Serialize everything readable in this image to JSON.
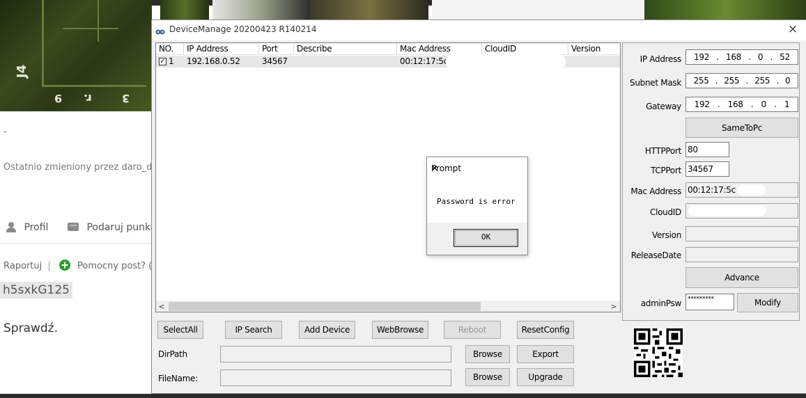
{
  "background_page": {
    "dash": "-",
    "edited_by": "Ostatnio zmieniony przez daro_da",
    "profile_link": "Profil",
    "donate_link": "Podaruj punkt",
    "report_link": "Raportuj",
    "separator": "|",
    "helpful_link": "Pomocny post? (",
    "code_text": "h5sxkG125",
    "reply_text": "Sprawdź.",
    "pcb_labels": [
      "J4",
      "9",
      "r.",
      "3"
    ]
  },
  "window": {
    "title": "DeviceManage 20200423 R140214",
    "close_glyph": "×"
  },
  "table": {
    "columns": [
      "NO.",
      "IP Address",
      "Port",
      "Describe",
      "Mac Address",
      "CloudID",
      "Version"
    ],
    "rows": [
      {
        "checked": true,
        "no": "1",
        "ip": "192.168.0.52",
        "port": "34567",
        "describe": "",
        "mac": "00:12:17:5c",
        "cloud_id": "",
        "version": ""
      }
    ],
    "scroll_left": "<",
    "scroll_right": ">"
  },
  "toolbar": {
    "select_all": "SelectAll",
    "ip_search": "IP Search",
    "add_device": "Add Device",
    "web_browse": "WebBrowse",
    "reboot": "Reboot",
    "reset_config": "ResetConfig",
    "dir_path_label": "DirPath",
    "dir_path_value": "",
    "file_name_label": "FileName:",
    "file_name_value": "",
    "browse1": "Browse",
    "export": "Export",
    "browse2": "Browse",
    "upgrade": "Upgrade"
  },
  "panel": {
    "ip_label": "IP Address",
    "ip_octets": [
      "192",
      "168",
      "0",
      "52"
    ],
    "mask_label": "Subnet Mask",
    "mask_octets": [
      "255",
      "255",
      "255",
      "0"
    ],
    "gateway_label": "Gateway",
    "gateway_octets": [
      "192",
      "168",
      "0",
      "1"
    ],
    "dot": ".",
    "same_to_pc": "SameToPc",
    "http_port_label": "HTTPPort",
    "http_port": "80",
    "tcp_port_label": "TCPPort",
    "tcp_port": "34567",
    "mac_label": "Mac Address",
    "mac": "00:12:17:5c",
    "cloud_label": "CloudID",
    "cloud_id": "",
    "version_label": "Version",
    "version": "",
    "release_label": "ReleaseDate",
    "release_date": "",
    "advance": "Advance",
    "admin_psw_label": "adminPsw",
    "admin_psw": "*********",
    "modify": "Modify"
  },
  "prompt": {
    "title": "Prompt",
    "close_glyph": "✕",
    "message": "Password is error",
    "ok": "OK"
  },
  "colors": {
    "window_bg": "#f0f0f0",
    "selected_row": "#e7e7e7",
    "button_face": "#e1e1e1"
  }
}
